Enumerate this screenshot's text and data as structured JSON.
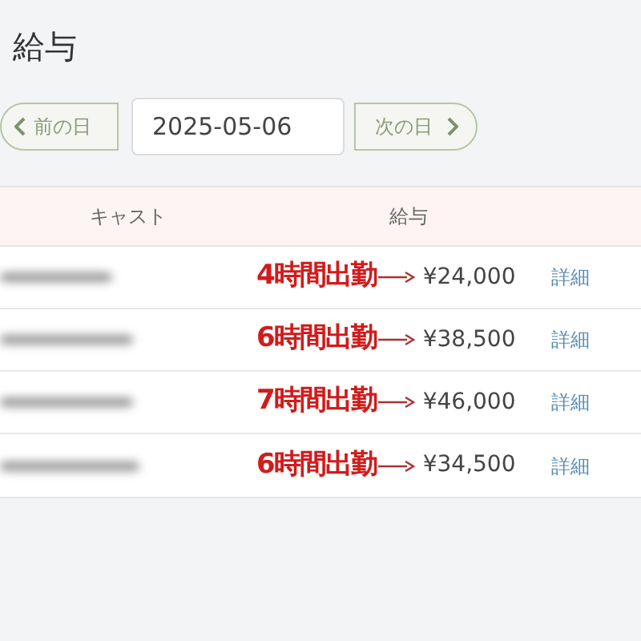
{
  "page": {
    "title": "給与"
  },
  "date_nav": {
    "prev_label": "前の日",
    "date": "2025-05-06",
    "next_label": "次の日"
  },
  "table": {
    "columns": [
      "キャスト",
      "給与"
    ],
    "rows": [
      {
        "annotation": "4時間出勤",
        "salary": "¥24,000",
        "link": "詳細"
      },
      {
        "annotation": "6時間出勤",
        "salary": "¥38,500",
        "link": "詳細"
      },
      {
        "annotation": "7時間出勤",
        "salary": "¥46,000",
        "link": "詳細"
      },
      {
        "annotation": "6時間出勤",
        "salary": "¥34,500",
        "link": "詳細"
      }
    ]
  }
}
